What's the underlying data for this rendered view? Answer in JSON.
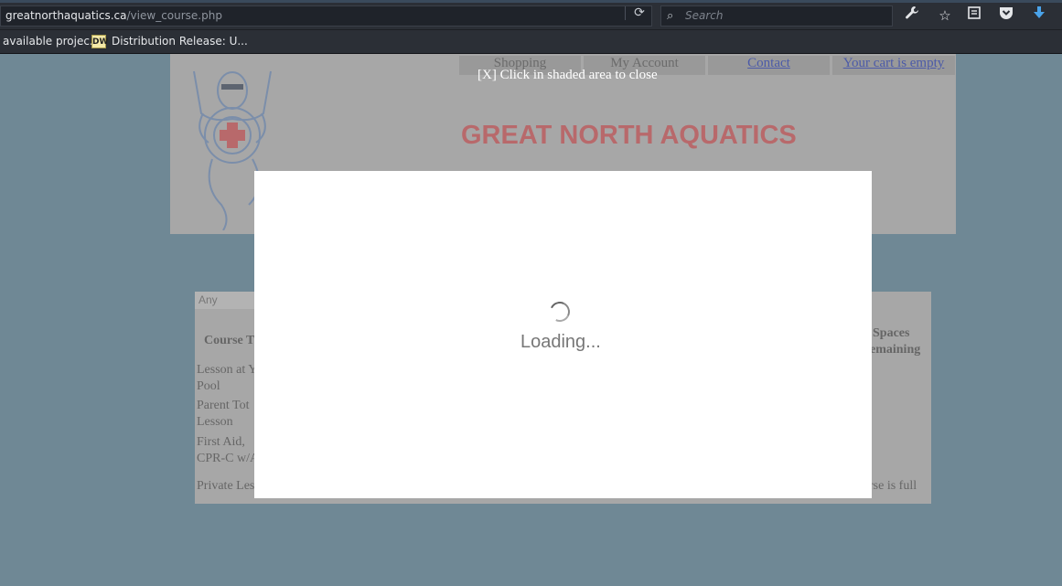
{
  "browser": {
    "url_host": "greatnorthaquatics.ca",
    "url_path": "/view_course.php",
    "search_placeholder": "Search",
    "bookmarks": [
      "available projec...",
      "Distribution Release: U..."
    ],
    "bookmark_favicon_text": "DW"
  },
  "site": {
    "title": "GREAT NORTH AQUATICS",
    "nav": [
      "Shopping",
      "My Account",
      "Contact",
      "Your cart is empty"
    ]
  },
  "courses": {
    "filter_value": "Any",
    "header_course": "Course T",
    "header_spaces_1": "Spaces",
    "header_spaces_2": "emaining",
    "rows": [
      [
        "Lesson at Y",
        "Pool"
      ],
      [
        "Parent Tot",
        "Lesson"
      ],
      [
        "First Aid,",
        "CPR-C w/A"
      ],
      [
        "Private Les"
      ]
    ],
    "full_text": "urse is full"
  },
  "overlay": {
    "close_hint": "[X] Click in shaded area to close",
    "loading": "Loading..."
  }
}
